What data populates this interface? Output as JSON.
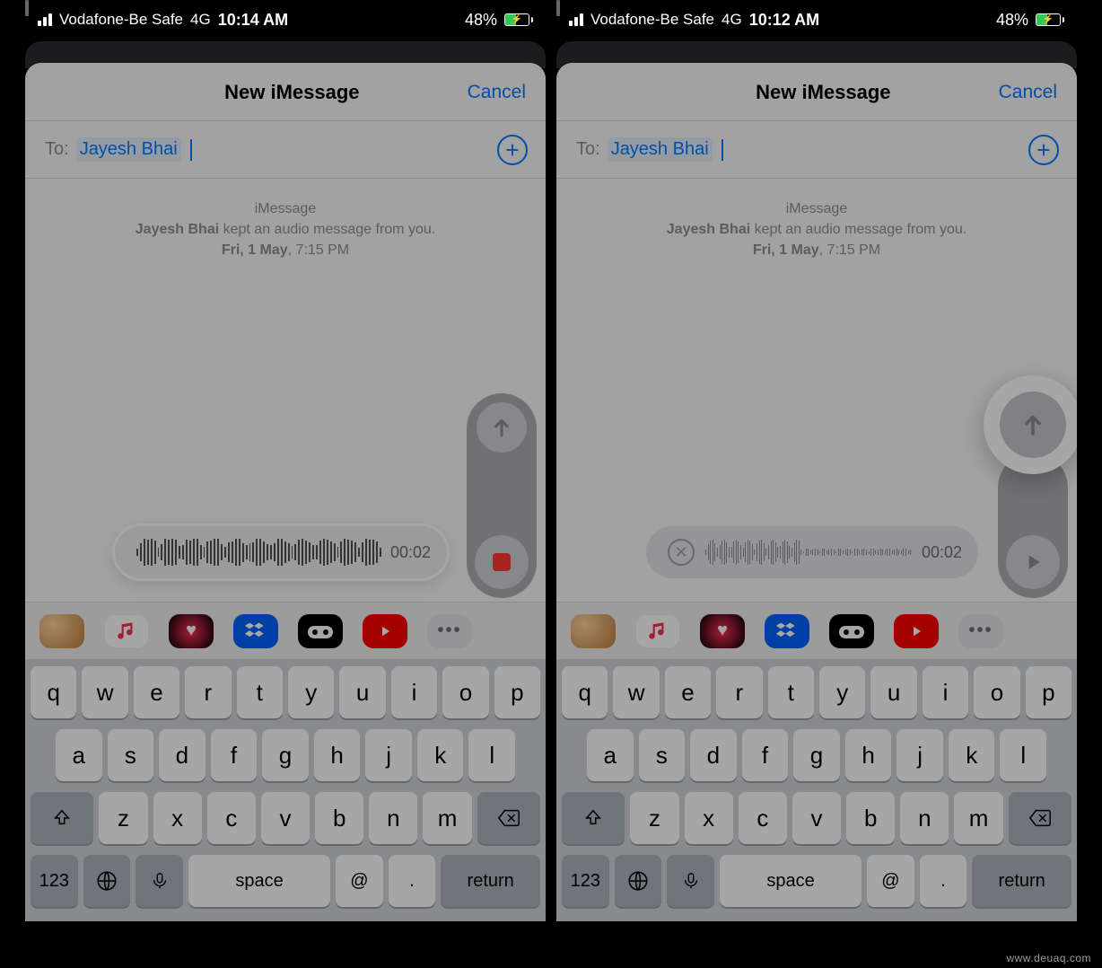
{
  "statusbar": {
    "carrier": "Vodafone-Be Safe",
    "network": "4G",
    "time_left": "10:14 AM",
    "time_right": "10:12 AM",
    "battery_pct": "48%"
  },
  "nav": {
    "title": "New iMessage",
    "cancel": "Cancel"
  },
  "to": {
    "label": "To:",
    "recipient": "Jayesh Bhai"
  },
  "info": {
    "line1": "iMessage",
    "line2_name": "Jayesh Bhai",
    "line2_rest": " kept an audio message from you.",
    "line3_date": "Fri, 1 May",
    "line3_time": ", 7:15 PM"
  },
  "audio": {
    "timer": "00:02"
  },
  "keyboard": {
    "row1": [
      "q",
      "w",
      "e",
      "r",
      "t",
      "y",
      "u",
      "i",
      "o",
      "p"
    ],
    "row2": [
      "a",
      "s",
      "d",
      "f",
      "g",
      "h",
      "j",
      "k",
      "l"
    ],
    "row3": [
      "z",
      "x",
      "c",
      "v",
      "b",
      "n",
      "m"
    ],
    "numbers": "123",
    "space": "space",
    "at": "@",
    "dot": ".",
    "return": "return"
  },
  "credit": "www.deuaq.com"
}
